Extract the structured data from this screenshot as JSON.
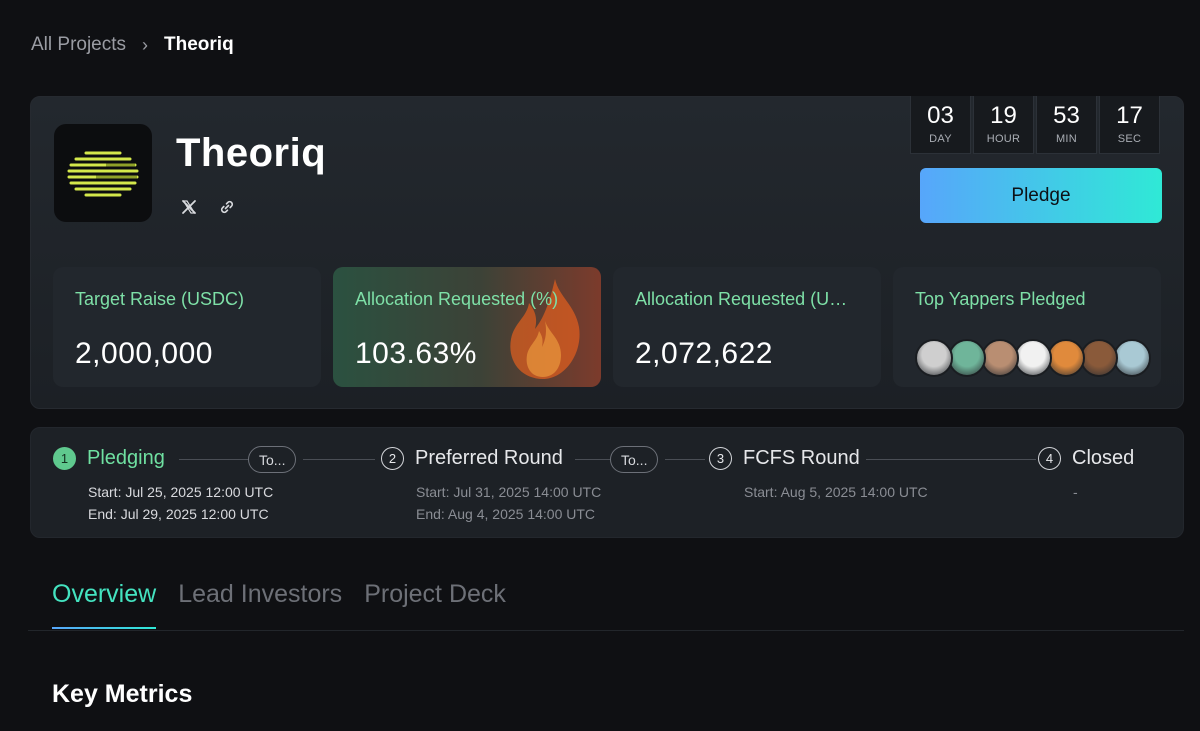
{
  "breadcrumb": {
    "parent": "All Projects",
    "separator": "›",
    "current": "Theoriq"
  },
  "project": {
    "name": "Theoriq",
    "socials": [
      {
        "icon": "x-icon"
      },
      {
        "icon": "link-icon"
      }
    ]
  },
  "countdown": {
    "days": "03",
    "days_label": "DAY",
    "hours": "19",
    "hours_label": "HOUR",
    "minutes": "53",
    "minutes_label": "MIN",
    "seconds": "17",
    "seconds_label": "SEC"
  },
  "pledge_label": "Pledge",
  "stats": [
    {
      "label": "Target Raise (USDC)",
      "value": "2,000,000"
    },
    {
      "label": "Allocation Requested (%)",
      "value": "103.63%"
    },
    {
      "label": "Allocation Requested (USDC)",
      "value": "2,072,622"
    },
    {
      "label": "Top Yappers Pledged",
      "value": ""
    }
  ],
  "yapper_avatar_colors": [
    "#cfcfcf",
    "#6fb59a",
    "#b98e72",
    "#f1f1f1",
    "#e08a3c",
    "#8a5a3a",
    "#a9c9d4"
  ],
  "timeline": {
    "steps": [
      {
        "number": "1",
        "title": "Pledging",
        "start": "Start: Jul 25, 2025 12:00 UTC",
        "end": "End: Jul 29, 2025 12:00 UTC"
      },
      {
        "number": "2",
        "title": "Preferred Round",
        "start": "Start: Jul 31, 2025 14:00 UTC",
        "end": "End: Aug 4, 2025 14:00 UTC"
      },
      {
        "number": "3",
        "title": "FCFS Round",
        "start": "Start: Aug 5, 2025 14:00 UTC"
      },
      {
        "number": "4",
        "title": "Closed",
        "start": "-"
      }
    ],
    "to_labels": [
      "To...",
      "To..."
    ]
  },
  "tabs": [
    {
      "label": "Overview",
      "active": true
    },
    {
      "label": "Lead Investors",
      "active": false
    },
    {
      "label": "Project Deck",
      "active": false
    }
  ],
  "section_title": "Key Metrics",
  "colors": {
    "accent_green": "#6fe0a1",
    "accent_teal": "#44e3c0",
    "pledge_gradient_start": "#57a6fb",
    "pledge_gradient_end": "#2fe9d6",
    "logo_stripes": "#d4e84b"
  }
}
